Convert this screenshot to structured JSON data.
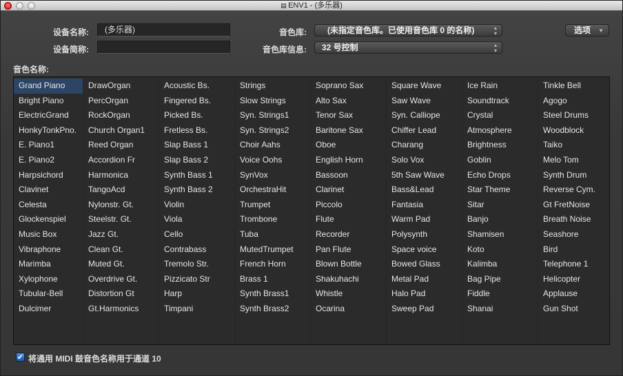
{
  "window": {
    "title": "ENV1 - (多乐器)"
  },
  "form": {
    "device_name_label": "设备名称:",
    "device_name_value": "(多乐器)",
    "device_short_label": "设备简称:",
    "device_short_value": "",
    "bank_label": "音色库:",
    "bank_value": "(未指定音色库。已使用音色库 0 的名称)",
    "bank_info_label": "音色库信息:",
    "bank_info_value": "32 号控制",
    "options_label": "选项",
    "patch_names_label": "音色名称:"
  },
  "patch_columns": [
    [
      "Grand Piano",
      "Bright Piano",
      "ElectricGrand",
      "HonkyTonkPno.",
      "E. Piano1",
      "E. Piano2",
      "Harpsichord",
      "Clavinet",
      "Celesta",
      "Glockenspiel",
      "Music Box",
      "Vibraphone",
      "Marimba",
      "Xylophone",
      "Tubular-Bell",
      "Dulcimer"
    ],
    [
      "DrawOrgan",
      "PercOrgan",
      "RockOrgan",
      "Church Organ1",
      "Reed Organ",
      "Accordion Fr",
      "Harmonica",
      "TangoAcd",
      "Nylonstr. Gt.",
      "Steelstr. Gt.",
      "Jazz Gt.",
      "Clean Gt.",
      "Muted Gt.",
      "Overdrive Gt.",
      "Distortion Gt",
      "Gt.Harmonics"
    ],
    [
      "Acoustic Bs.",
      "Fingered Bs.",
      "Picked Bs.",
      "Fretless Bs.",
      "Slap Bass 1",
      "Slap Bass 2",
      "Synth Bass 1",
      "Synth Bass 2",
      "Violin",
      "Viola",
      "Cello",
      "Contrabass",
      "Tremolo Str.",
      "Pizzicato Str",
      "Harp",
      "Timpani"
    ],
    [
      "Strings",
      "Slow Strings",
      "Syn. Strings1",
      "Syn. Strings2",
      "Choir Aahs",
      "Voice Oohs",
      "SynVox",
      "OrchestraHit",
      "Trumpet",
      "Trombone",
      "Tuba",
      "MutedTrumpet",
      "French Horn",
      "Brass 1",
      "Synth Brass1",
      "Synth Brass2"
    ],
    [
      "Soprano Sax",
      "Alto Sax",
      "Tenor Sax",
      "Baritone Sax",
      "Oboe",
      "English Horn",
      "Bassoon",
      "Clarinet",
      "Piccolo",
      "Flute",
      "Recorder",
      "Pan Flute",
      "Blown Bottle",
      "Shakuhachi",
      "Whistle",
      "Ocarina"
    ],
    [
      "Square Wave",
      "Saw Wave",
      "Syn. Calliope",
      "Chiffer Lead",
      "Charang",
      "Solo Vox",
      "5th Saw Wave",
      "Bass&Lead",
      "Fantasia",
      "Warm Pad",
      "Polysynth",
      "Space voice",
      "Bowed Glass",
      "Metal Pad",
      "Halo Pad",
      "Sweep Pad"
    ],
    [
      "Ice Rain",
      "Soundtrack",
      "Crystal",
      "Atmosphere",
      "Brightness",
      "Goblin",
      "Echo Drops",
      "Star Theme",
      "Sitar",
      "Banjo",
      "Shamisen",
      "Koto",
      "Kalimba",
      "Bag Pipe",
      "Fiddle",
      "Shanai"
    ],
    [
      "Tinkle Bell",
      "Agogo",
      "Steel Drums",
      "Woodblock",
      "Taiko",
      "Melo Tom",
      "Synth Drum",
      "Reverse Cym.",
      "Gt FretNoise",
      "Breath Noise",
      "Seashore",
      "Bird",
      "Telephone 1",
      "Helicopter",
      "Applause",
      "Gun Shot"
    ]
  ],
  "selected_patch": "Grand Piano",
  "checkbox": {
    "label": "将通用 MIDI 鼓音色名称用于通道 10",
    "checked": true
  }
}
